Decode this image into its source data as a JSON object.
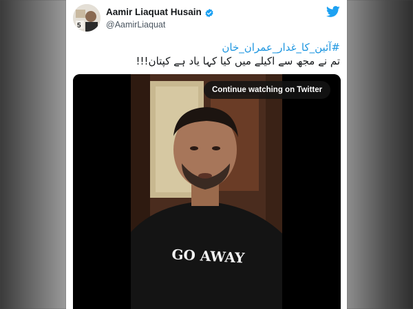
{
  "tweet": {
    "author_name": "Aamir Liaquat Husain",
    "author_handle": "@AamirLiaquat",
    "hashtag": "#آئین_کا_غدار_عمران_خان",
    "text": "تم نے مجھ سے اکیلے میں کیا کہا یاد ہے کپتان!!!",
    "avatar_digit": "5"
  },
  "video": {
    "continue_label": "Continue watching on Twitter",
    "shirt_text": "GO AWAY"
  },
  "colors": {
    "link": "#1b95e0",
    "verified": "#1da1f2",
    "twitter_brand": "#1da1f2"
  },
  "icons": [
    "verified-badge-icon",
    "twitter-bird-icon"
  ]
}
